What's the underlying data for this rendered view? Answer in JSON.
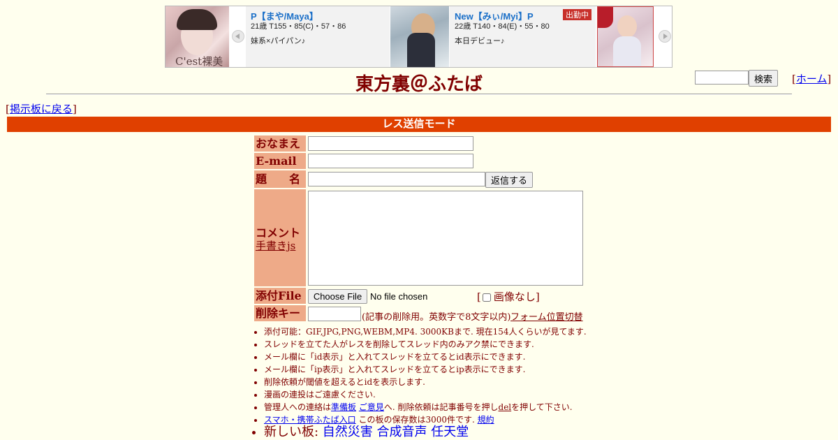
{
  "banner": {
    "cards": [
      {
        "name": "P【まや/Maya】",
        "stats": "21歳 T155・85(C)・57・86",
        "desc": "妹系×パイパン♪"
      },
      {
        "name": "New【みぃ/Myi】P",
        "stats": "22歳 T140・84(E)・55・80",
        "desc": "本日デビュー♪",
        "badge": "出勤中"
      }
    ],
    "thumb_caption": "C'est裸美"
  },
  "header": {
    "title": "東方裏＠ふたば",
    "search_button": "検索",
    "home_link": "ホーム"
  },
  "nav": {
    "back_link": "掲示板に戻る"
  },
  "mode_bar": "レス送信モード",
  "form": {
    "name_label": "おなまえ",
    "email_label": "E-mail",
    "subject_label": "題　　名",
    "submit_button": "返信する",
    "comment_label": "コメント",
    "handwriting_link": "手書きjs",
    "file_label": "添付File",
    "file_button": "Choose File",
    "file_status": "No file chosen",
    "no_image_label": "画像なし",
    "delete_key_label": "削除キー",
    "delete_key_note": "(記事の削除用。英数字で8文字以内)",
    "form_position_link": "フォーム位置切替"
  },
  "notes": [
    "添付可能：GIF,JPG,PNG,WEBM,MP4. 3000KBまで. 現在154人くらいが見てます.",
    "スレッドを立てた人がレスを削除してスレッド内のみアク禁にできます.",
    "メール欄に「id表示」と入れてスレッドを立てるとid表示にできます.",
    "メール欄に「ip表示」と入れてスレッドを立てるとip表示にできます.",
    "削除依頼が閾値を超えるとidを表示します.",
    "漫画の連投はご遠慮ください."
  ],
  "note_contact": {
    "prefix": "管理人への連絡は",
    "link1": "準備板",
    "link2": "ご意見",
    "middle": "へ. 削除依頼は記事番号を押し",
    "link3": "del",
    "suffix": "を押して下さい."
  },
  "note_mobile": {
    "link": "スマホ・携帯ふたば入口",
    "text": " この板の保存数は3000件です. ",
    "rules_link": "規約"
  },
  "new_boards": {
    "label": "新しい板: ",
    "boards": [
      "自然災害",
      "合成音声",
      "任天堂"
    ]
  },
  "colors": {
    "mode_bar": "#e04000",
    "label_bg": "#eeaa88",
    "text": "#800000",
    "page_bg": "#ffffee"
  }
}
